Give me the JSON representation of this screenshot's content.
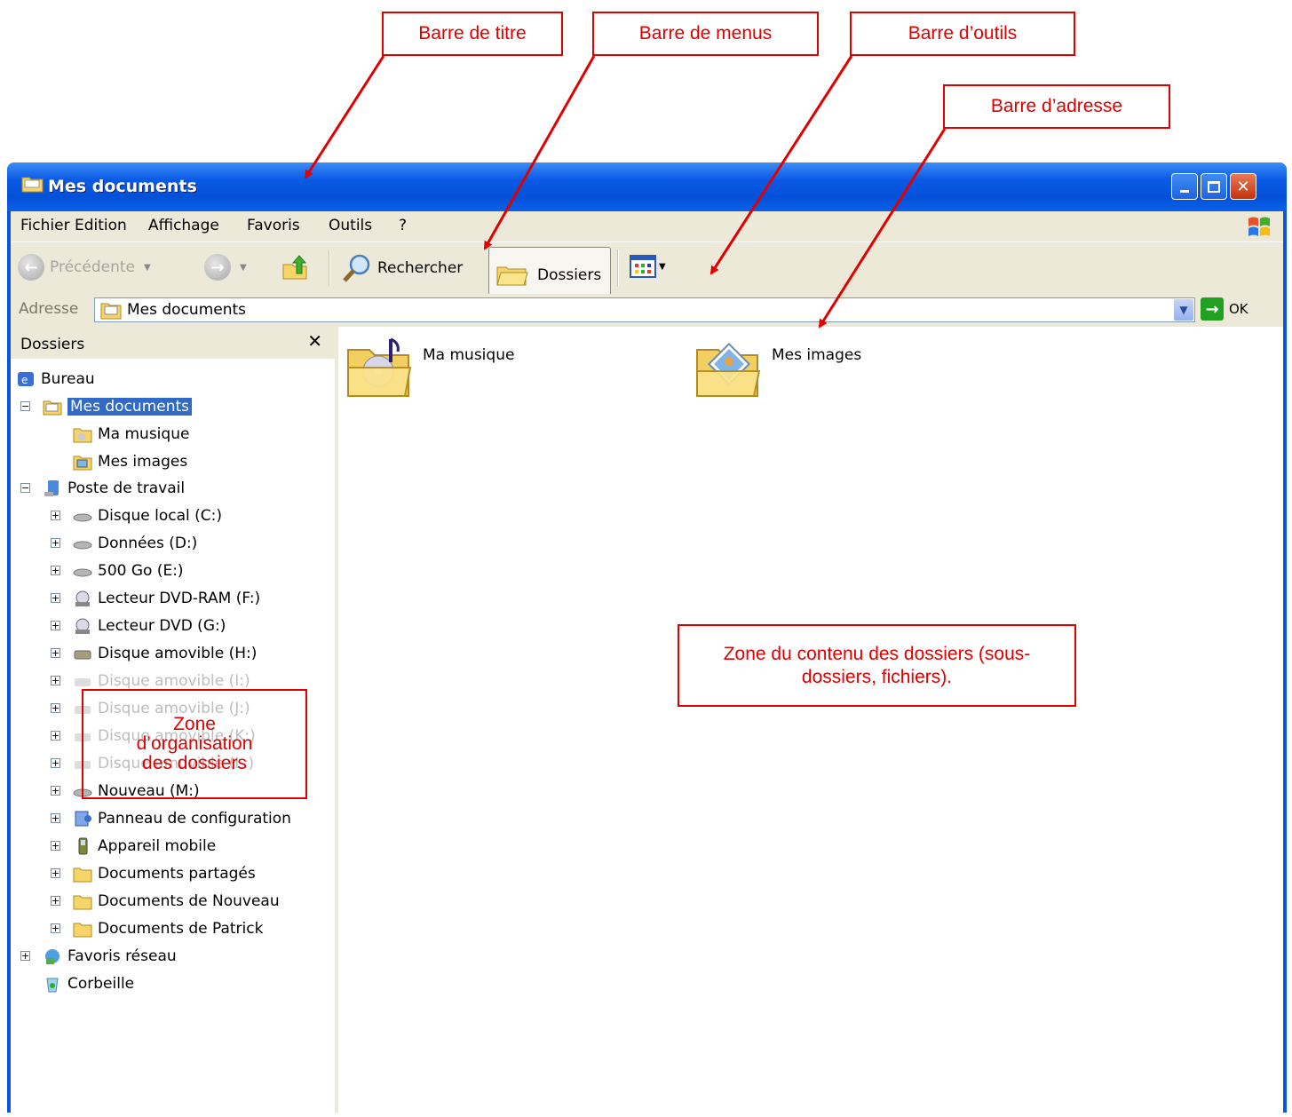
{
  "annotations": {
    "title_bar": "Barre de titre",
    "menu_bar": "Barre de menus",
    "toolbar": "Barre d’outils",
    "address_bar": "Barre d’adresse",
    "content_zone": "Zone du contenu des dossiers (sous-dossiers, fichiers).",
    "folders_zone_line1": "Zone",
    "folders_zone_line2": "d’organisation",
    "folders_zone_line3": "des dossiers",
    "color": "#e00000"
  },
  "window": {
    "title": "Mes documents",
    "buttons": [
      "minimize-icon",
      "maximize-icon",
      "close-icon"
    ]
  },
  "menu": {
    "items": [
      "Fichier",
      "Edition",
      "Affichage",
      "Favoris",
      "Outils",
      "?"
    ]
  },
  "toolbar": {
    "back": "Précédente",
    "search": "Rechercher",
    "folders": "Dossiers"
  },
  "address": {
    "label": "Adresse",
    "value": "Mes documents",
    "go": "OK"
  },
  "folders_pane": {
    "title": "Dossiers",
    "tree": [
      "Bureau",
      "Mes documents",
      "Ma musique",
      "Mes images",
      "Poste de travail",
      "Disque local (C:)",
      "Données (D:)",
      "500 Go (E:)",
      "Lecteur DVD-RAM (F:)",
      "Lecteur DVD (G:)",
      "Disque amovible (H:)",
      "Disque amovible (I:)",
      "Disque amovible (J:)",
      "Disque amovible (K:)",
      "Disque amovible (L:)",
      "Nouveau (M:)",
      "Panneau de configuration",
      "Appareil mobile",
      "Documents partagés",
      "Documents de Nouveau",
      "Documents de Patrick",
      "Favoris réseau",
      "Corbeille"
    ]
  },
  "content": {
    "items": [
      "Ma musique",
      "Mes images"
    ]
  },
  "colors": {
    "titlebar": "#0a55e0",
    "chrome": "#ece9d8",
    "selection": "#316ac5"
  }
}
